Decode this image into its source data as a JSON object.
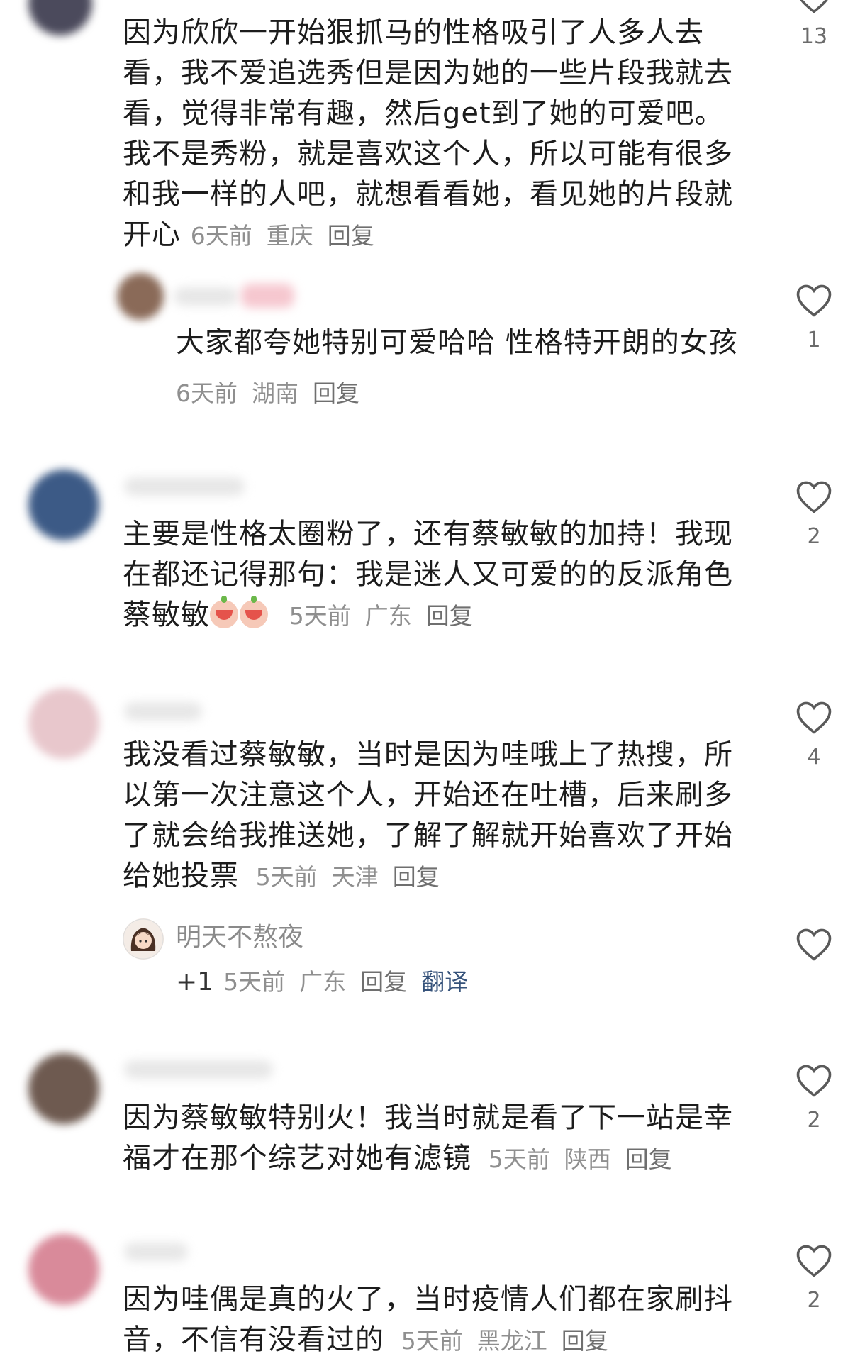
{
  "comments": [
    {
      "lines": [
        "因为欣欣一开始狠抓马的性格吸引了人多人去",
        "看，我不爱追选秀但是因为她的一些片段我就去",
        "看，觉得非常有趣，然后get到了她的可爱吧。",
        "我不是秀粉，就是喜欢这个人，所以可能有很多",
        "和我一样的人吧，就想看看她，看见她的片段就",
        "开心"
      ],
      "time": "6天前",
      "location": "重庆",
      "reply": "回复",
      "likes": "13",
      "avatar_color": "#4b4a5c"
    },
    {
      "lines": [
        "大家都夸她特别可爱哈哈 性格特开朗的女孩"
      ],
      "time": "6天前",
      "location": "湖南",
      "reply": "回复",
      "likes": "1",
      "avatar_color": "#8a6a58"
    },
    {
      "lines": [
        "主要是性格太圈粉了，还有蔡敏敏的加持！我现",
        "在都还记得那句：我是迷人又可爱的的反派角色",
        "蔡敏敏"
      ],
      "time": "5天前",
      "location": "广东",
      "reply": "回复",
      "likes": "2",
      "avatar_color": "#3c5a86"
    },
    {
      "lines": [
        "我没看过蔡敏敏，当时是因为哇哦上了热搜，所",
        "以第一次注意这个人，开始还在吐槽，后来刷多",
        "了就会给我推送她，了解了解就开始喜欢了开始",
        "给她投票"
      ],
      "time": "5天前",
      "location": "天津",
      "reply": "回复",
      "likes": "4",
      "avatar_color": "#e8c7cc"
    },
    {
      "name": "明天不熬夜",
      "prefix": "+1",
      "time": "5天前",
      "location": "广东",
      "reply": "回复",
      "translate": "翻译",
      "likes": "",
      "avatar_color": "#5a3b2e"
    },
    {
      "lines": [
        "因为蔡敏敏特别火！我当时就是看了下一站是幸",
        "福才在那个综艺对她有滤镜"
      ],
      "time": "5天前",
      "location": "陕西",
      "reply": "回复",
      "likes": "2",
      "avatar_color": "#6e5a50"
    },
    {
      "lines": [
        "因为哇偶是真的火了，当时疫情人们都在家刷抖",
        "音，不信有没看过的"
      ],
      "time": "5天前",
      "location": "黑龙江",
      "reply": "回复",
      "likes": "2",
      "avatar_color": "#d98a9a"
    }
  ],
  "icons": {
    "like": "heart-outline-icon",
    "emoji": "crying-face-emoji"
  },
  "colors": {
    "text": "#1c1c1c",
    "meta": "#8f8f8f",
    "translate": "#35527a",
    "icon": "#5a5a5a"
  }
}
